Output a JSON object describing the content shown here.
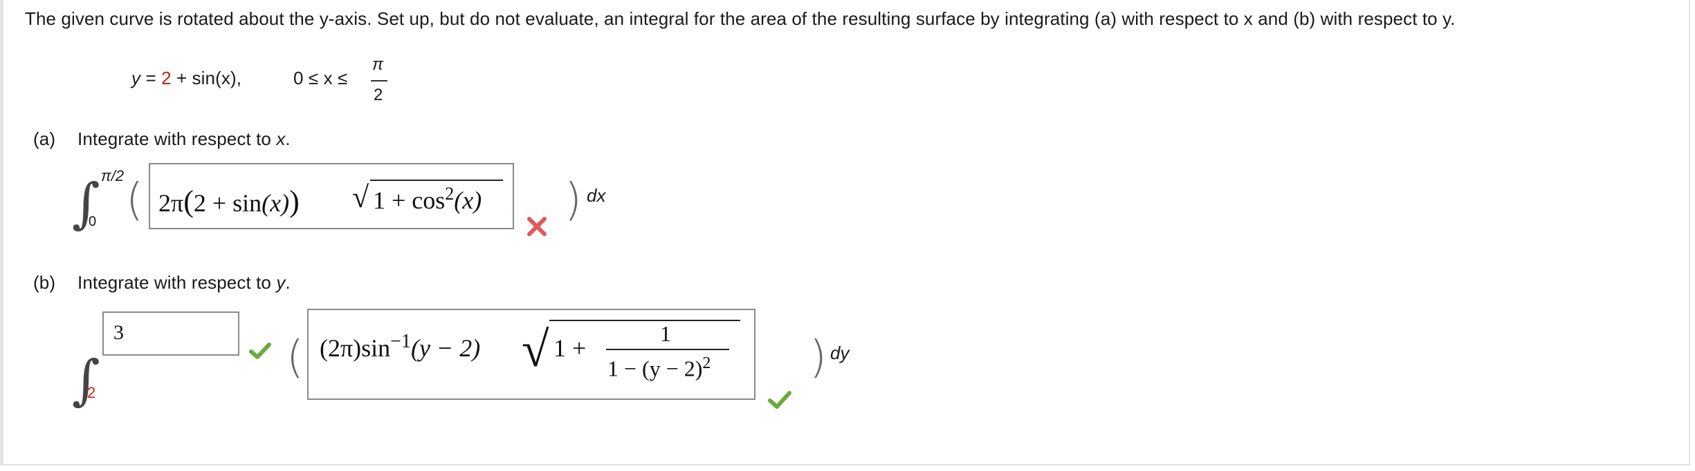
{
  "problem": {
    "intro": "The given curve is rotated about the y-axis. Set up, but do not evaluate, an integral for the area of the resulting surface by integrating (a) with respect to x and (b) with respect to y.",
    "curve": {
      "lhs": "y =",
      "const": "2",
      "rest": "+ sin(x),",
      "domain": "0 ≤ x ≤",
      "pi": "π",
      "den": "2"
    }
  },
  "part_a": {
    "tag": "(a)",
    "label": "Integrate with respect to x.",
    "upper_limit": "π/2",
    "lower_limit": "0",
    "answer": {
      "coef": "2π",
      "open": "(",
      "expr": "2 + sin",
      "paren_x": "(x)",
      "close": ")",
      "sqrt_inner": "1 + cos",
      "exp": "2",
      "arg": "(x)"
    },
    "status": "incorrect",
    "status_color": "#e05858",
    "differential": "dx"
  },
  "part_b": {
    "tag": "(b)",
    "label": "Integrate with respect to y.",
    "upper_limit_value": "3",
    "lower_limit": "2",
    "upper_status": "correct",
    "answer": {
      "coef": "(2π)sin",
      "inv": "−1",
      "arg": "(y − 2)",
      "sqrt_prefix": "1 +",
      "num": "1",
      "den": "1 − (y − 2)",
      "den_exp": "2"
    },
    "status": "correct",
    "status_color": "#6aab3e",
    "differential": "dy"
  }
}
